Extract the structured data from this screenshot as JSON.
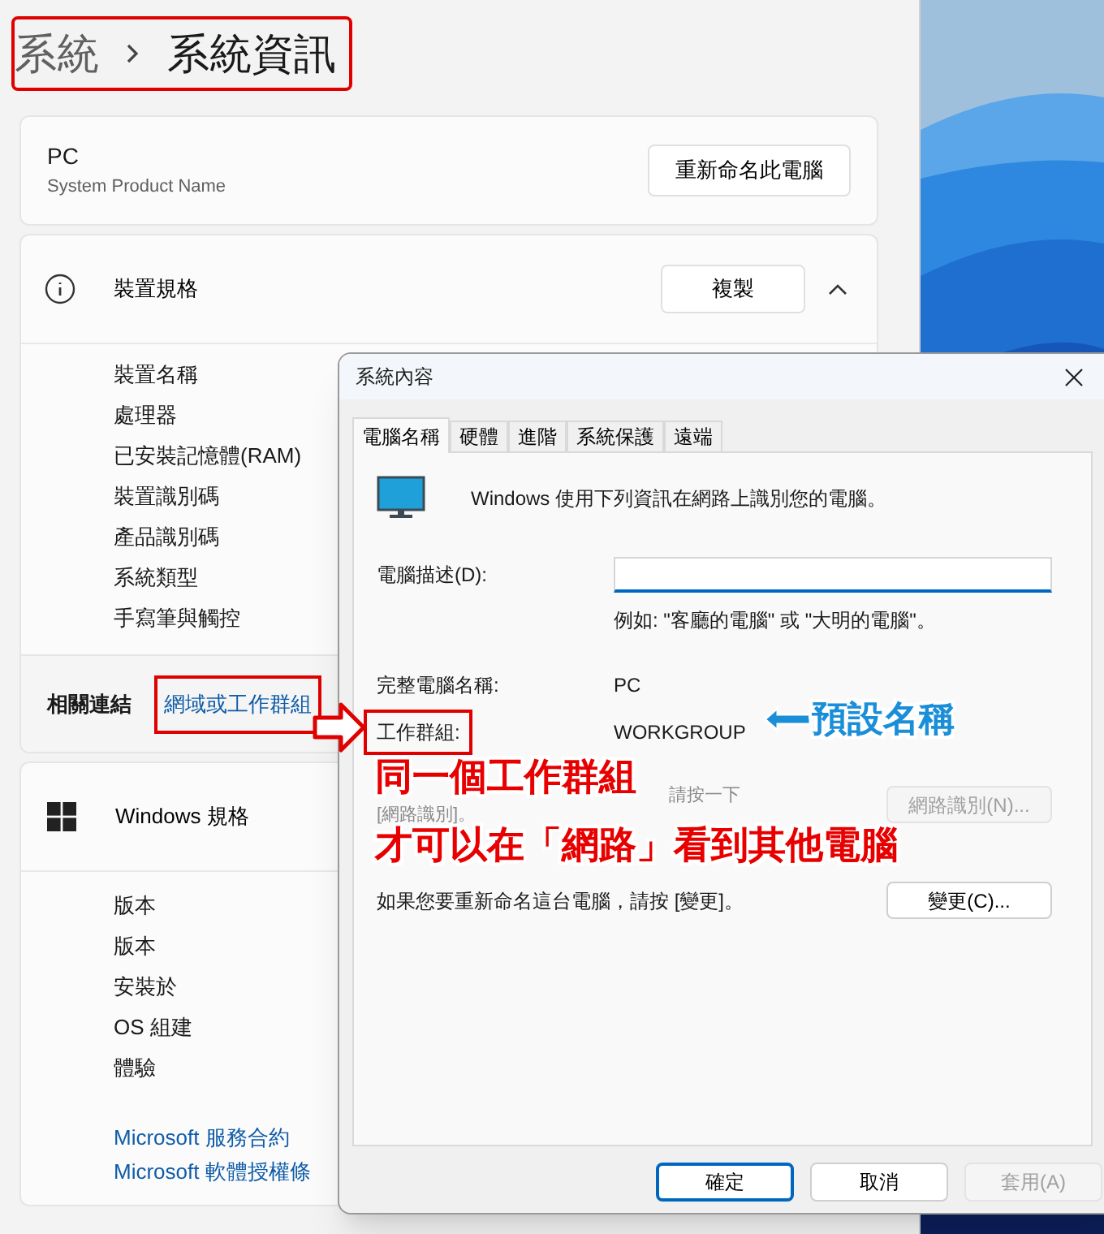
{
  "breadcrumb": {
    "parent": "系統",
    "current": "系統資訊"
  },
  "pc_card": {
    "name": "PC",
    "model": "System Product Name",
    "rename_button": "重新命名此電腦"
  },
  "device_specs": {
    "title": "裝置規格",
    "copy_button": "複製",
    "expanded": true,
    "rows": [
      "裝置名稱",
      "處理器",
      "已安裝記憶體(RAM)",
      "裝置識別碼",
      "產品識別碼",
      "系統類型",
      "手寫筆與觸控"
    ]
  },
  "related_links": {
    "label": "相關連結",
    "links": [
      "網域或工作群組"
    ]
  },
  "windows_specs": {
    "title": "Windows 規格",
    "rows": [
      "版本",
      "版本",
      "安裝於",
      "OS 組建",
      "體驗"
    ],
    "links": [
      "Microsoft 服務合約",
      "Microsoft 軟體授權條"
    ]
  },
  "dialog": {
    "title": "系統內容",
    "tabs": [
      {
        "label": "電腦名稱",
        "selected": true
      },
      {
        "label": "硬體",
        "selected": false
      },
      {
        "label": "進階",
        "selected": false
      },
      {
        "label": "系統保護",
        "selected": false
      },
      {
        "label": "遠端",
        "selected": false
      }
    ],
    "intro": "Windows 使用下列資訊在網路上識別您的電腦。",
    "description_label": "電腦描述(D):",
    "description_hint": "例如: \"客廳的電腦\" 或 \"大明的電腦\"。",
    "fields": [
      {
        "label": "完整電腦名稱:",
        "value": "PC"
      },
      {
        "label": "工作群組:",
        "value": "WORKGROUP"
      }
    ],
    "network_id_text": [
      "請按一下",
      "[網路識別]。"
    ],
    "network_id_button": {
      "label": "網路識別(N)...",
      "disabled": true
    },
    "rename_text": "如果您要重新命名這台電腦，請按 [變更]。",
    "change_button": {
      "label": "變更(C)...",
      "disabled": false
    },
    "buttons": [
      {
        "label": "確定",
        "default": true,
        "disabled": false
      },
      {
        "label": "取消",
        "default": false,
        "disabled": false
      },
      {
        "label": "套用(A)",
        "default": false,
        "disabled": true
      }
    ]
  },
  "annotations": {
    "callout_lines": [
      "同一個工作群組",
      "才可以在「網路」看到其他電腦"
    ],
    "default_name_note": "預設名稱"
  }
}
